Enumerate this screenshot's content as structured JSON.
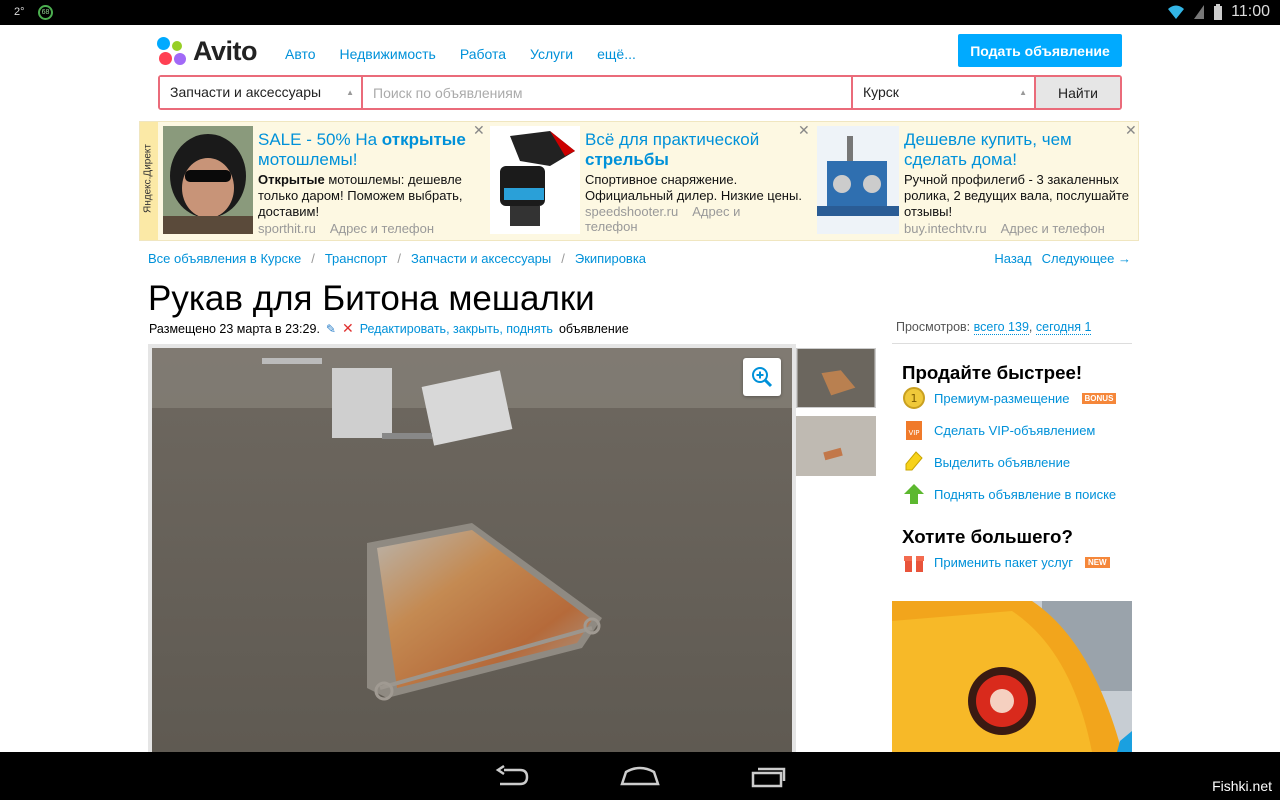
{
  "statusbar": {
    "temp": "2°",
    "battery_badge": "68",
    "time": "11:00"
  },
  "header": {
    "logo_text": "Avito",
    "nav": [
      "Авто",
      "Недвижимость",
      "Работа",
      "Услуги",
      "ещё..."
    ],
    "post_button": "Подать объявление"
  },
  "search": {
    "category": "Запчасти и аксессуары",
    "placeholder": "Поиск по объявлениям",
    "city": "Курск",
    "find_button": "Найти"
  },
  "ads": {
    "label": "Яндекс.Директ",
    "items": [
      {
        "title_pre": "SALE - 50% На ",
        "title_bold": "открытые",
        "title_post": " мотошлемы!",
        "desc_bold": "Открытые",
        "desc": " мотошлемы: дешевле только даром! Поможем выбрать, доставим!",
        "domain": "sporthit.ru",
        "contacts": "Адрес и телефон"
      },
      {
        "title_pre": "Всё для практической ",
        "title_bold": "стрельбы",
        "title_post": "",
        "desc_bold": "",
        "desc": "Спортивное снаряжение. Официальный дилер. Низкие цены.",
        "domain": "speedshooter.ru",
        "contacts": "Адрес и телефон"
      },
      {
        "title_pre": "Дешевле купить, чем сделать дома!",
        "title_bold": "",
        "title_post": "",
        "desc_bold": "",
        "desc": "Ручной профилегиб - 3 закаленных ролика, 2 ведущих вала, послушайте отзывы!",
        "domain": "buy.intechtv.ru",
        "contacts": "Адрес и телефон"
      }
    ]
  },
  "breadcrumbs": [
    "Все объявления в Курске",
    "Транспорт",
    "Запчасти и аксессуары",
    "Экипировка"
  ],
  "pager": {
    "back": "Назад",
    "next": "Следующее →"
  },
  "item": {
    "title": "Рукав для Битона мешалки",
    "posted": "Размещено 23 марта в 23:29.",
    "edit_link": "Редактировать, закрыть, поднять",
    "edit_suffix": "объявление"
  },
  "views": {
    "label": "Просмотров:",
    "total": "всего 139",
    "today": "сегодня 1"
  },
  "sidebar": {
    "sell_faster": "Продайте быстрее!",
    "services": [
      {
        "label": "Премиум-размещение",
        "tag": "BONUS"
      },
      {
        "label": "Сделать VIP-объявлением",
        "tag": ""
      },
      {
        "label": "Выделить объявление",
        "tag": ""
      },
      {
        "label": "Поднять объявление в поиске",
        "tag": ""
      }
    ],
    "want_more": "Хотите большего?",
    "package": {
      "label": "Применить пакет услуг",
      "tag": "NEW"
    }
  },
  "navbar": {
    "watermark": "Fishki.net"
  },
  "colors": {
    "link": "#0091d9",
    "accent": "#00aaff",
    "search_border": "#ea6b7a"
  }
}
